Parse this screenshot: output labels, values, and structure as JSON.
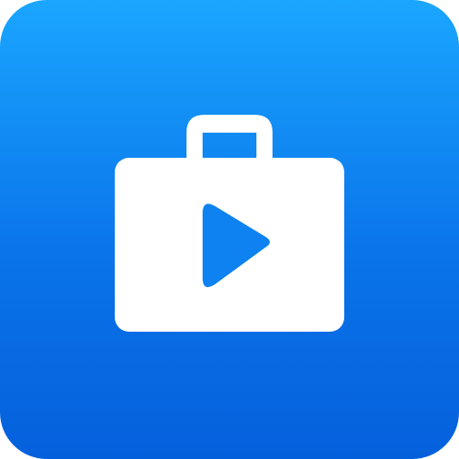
{
  "icon": {
    "name": "video-briefcase-app-icon",
    "glyph": "briefcase-with-play-icon",
    "colors": {
      "gradient_top": "#1aa6ff",
      "gradient_bottom": "#0560dc",
      "glyph_fill": "#ffffff",
      "play_fill": "#0d82f0"
    }
  }
}
